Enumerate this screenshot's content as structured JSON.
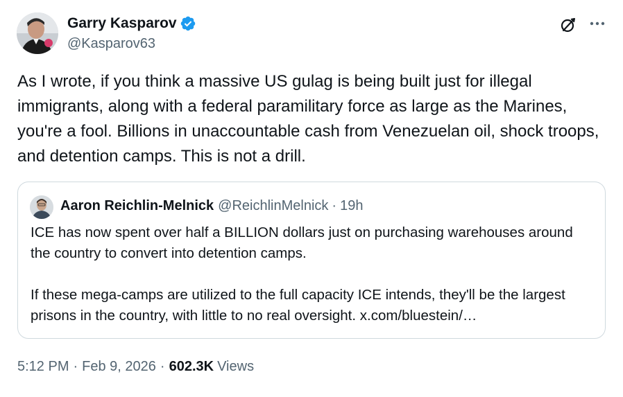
{
  "author": {
    "name": "Garry Kasparov",
    "handle": "@Kasparov63"
  },
  "header_actions": {
    "grok_icon": "grok-icon",
    "more_icon": "more-icon"
  },
  "tweet": {
    "text": "As I wrote, if you think a massive US gulag is being built just for illegal immigrants, along with a federal paramilitary force as large as the Marines, you're a fool. Billions in unaccountable cash from Venezuelan oil, shock troops, and detention camps. This is not a drill."
  },
  "quote": {
    "name": "Aaron Reichlin-Melnick",
    "handle": "@ReichlinMelnick",
    "separator": "·",
    "time": "19h",
    "paragraph1": "ICE has now spent over half a BILLION dollars just on purchasing warehouses around the country to convert into detention camps.",
    "paragraph2": "If these mega-camps are utilized to the full capacity ICE intends, they'll be the largest prisons in the country, with little to no real oversight. x.com/bluestein/…"
  },
  "meta": {
    "time": "5:12 PM",
    "separator": "·",
    "date": "Feb 9, 2026",
    "views_count": "602.3K",
    "views_label": "Views"
  },
  "colors": {
    "text": "#0f1419",
    "secondary": "#536471",
    "verified": "#1d9bf0",
    "border": "#cfd9de"
  }
}
